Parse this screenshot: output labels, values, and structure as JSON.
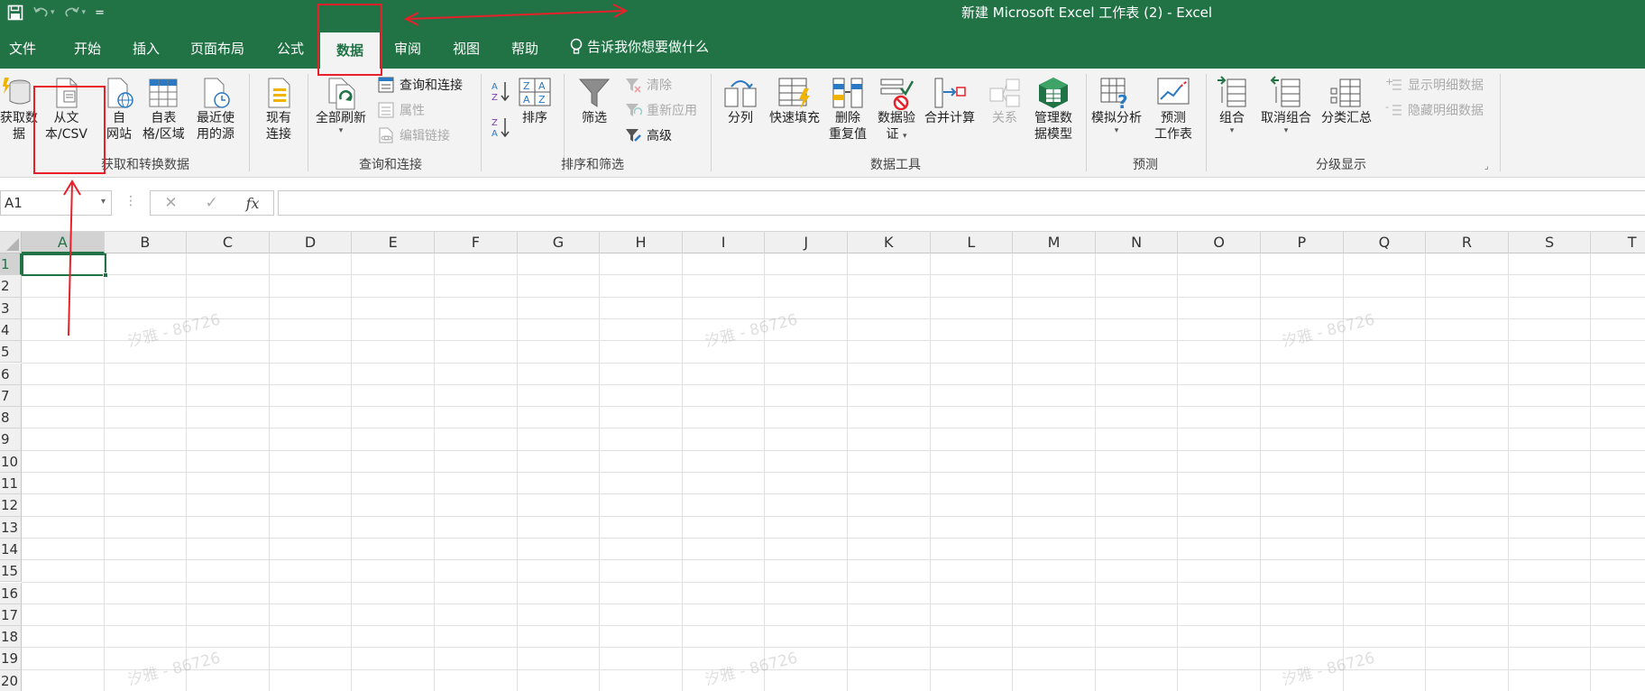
{
  "window": {
    "title": "新建 Microsoft Excel 工作表 (2)  -  Excel"
  },
  "quick_access": {
    "customize_symbol": "="
  },
  "tabs": [
    {
      "id": "file",
      "label": "文件"
    },
    {
      "id": "home",
      "label": "开始"
    },
    {
      "id": "insert",
      "label": "插入"
    },
    {
      "id": "layout",
      "label": "页面布局"
    },
    {
      "id": "formulas",
      "label": "公式"
    },
    {
      "id": "data",
      "label": "数据",
      "active": true
    },
    {
      "id": "review",
      "label": "审阅"
    },
    {
      "id": "view",
      "label": "视图"
    },
    {
      "id": "help",
      "label": "帮助"
    }
  ],
  "tell_me": {
    "label": "告诉我你想要做什么"
  },
  "ribbon": {
    "get_transform": {
      "group_label": "获取和转换数据",
      "get_data": {
        "line1": "获取数",
        "line2": "据"
      },
      "from_text": {
        "line1": "从文",
        "line2": "本/CSV"
      },
      "from_web": {
        "line1": "自",
        "line2": "网站"
      },
      "from_table": {
        "line1": "自表",
        "line2": "格/区域"
      },
      "recent_sources": {
        "line1": "最近使",
        "line2": "用的源"
      },
      "existing": {
        "line1": "现有",
        "line2": "连接"
      }
    },
    "queries": {
      "group_label": "查询和连接",
      "refresh_all": "全部刷新",
      "queries_connections": "查询和连接",
      "properties": "属性",
      "edit_links": "编辑链接"
    },
    "sort_filter": {
      "group_label": "排序和筛选",
      "sort": "排序",
      "filter": "筛选",
      "clear": "清除",
      "reapply": "重新应用",
      "advanced": "高级"
    },
    "data_tools": {
      "group_label": "数据工具",
      "text_to_columns": "分列",
      "flash_fill": "快速填充",
      "remove_dup": {
        "line1": "删除",
        "line2": "重复值"
      },
      "validation": {
        "line1": "数据验",
        "line2": "证"
      },
      "consolidate": "合并计算",
      "relationships": "关系",
      "data_model": {
        "line1": "管理数",
        "line2": "据模型"
      }
    },
    "forecast": {
      "group_label": "预测",
      "what_if": "模拟分析",
      "forecast_sheet": {
        "line1": "预测",
        "line2": "工作表"
      }
    },
    "outline": {
      "group_label": "分级显示",
      "group": "组合",
      "ungroup": "取消组合",
      "subtotal": "分类汇总",
      "show_detail": "显示明细数据",
      "hide_detail": "隐藏明细数据"
    }
  },
  "formula_bar": {
    "name_box": "A1",
    "cancel": "✕",
    "enter": "✓",
    "fx": "fx",
    "value": ""
  },
  "grid": {
    "columns": [
      "A",
      "B",
      "C",
      "D",
      "E",
      "F",
      "G",
      "H",
      "I",
      "J",
      "K",
      "L",
      "M",
      "N",
      "O",
      "P",
      "Q",
      "R",
      "S",
      "T"
    ],
    "rows": [
      "1",
      "2",
      "3",
      "4",
      "5",
      "6",
      "7",
      "8",
      "9",
      "10",
      "11",
      "12",
      "13",
      "14",
      "15",
      "16",
      "17",
      "18",
      "19",
      "20"
    ],
    "active_cell": "A1"
  },
  "watermark": "汐雅 - 86726",
  "colors": {
    "excel_green": "#217346",
    "annotation_red": "#e8202a"
  }
}
